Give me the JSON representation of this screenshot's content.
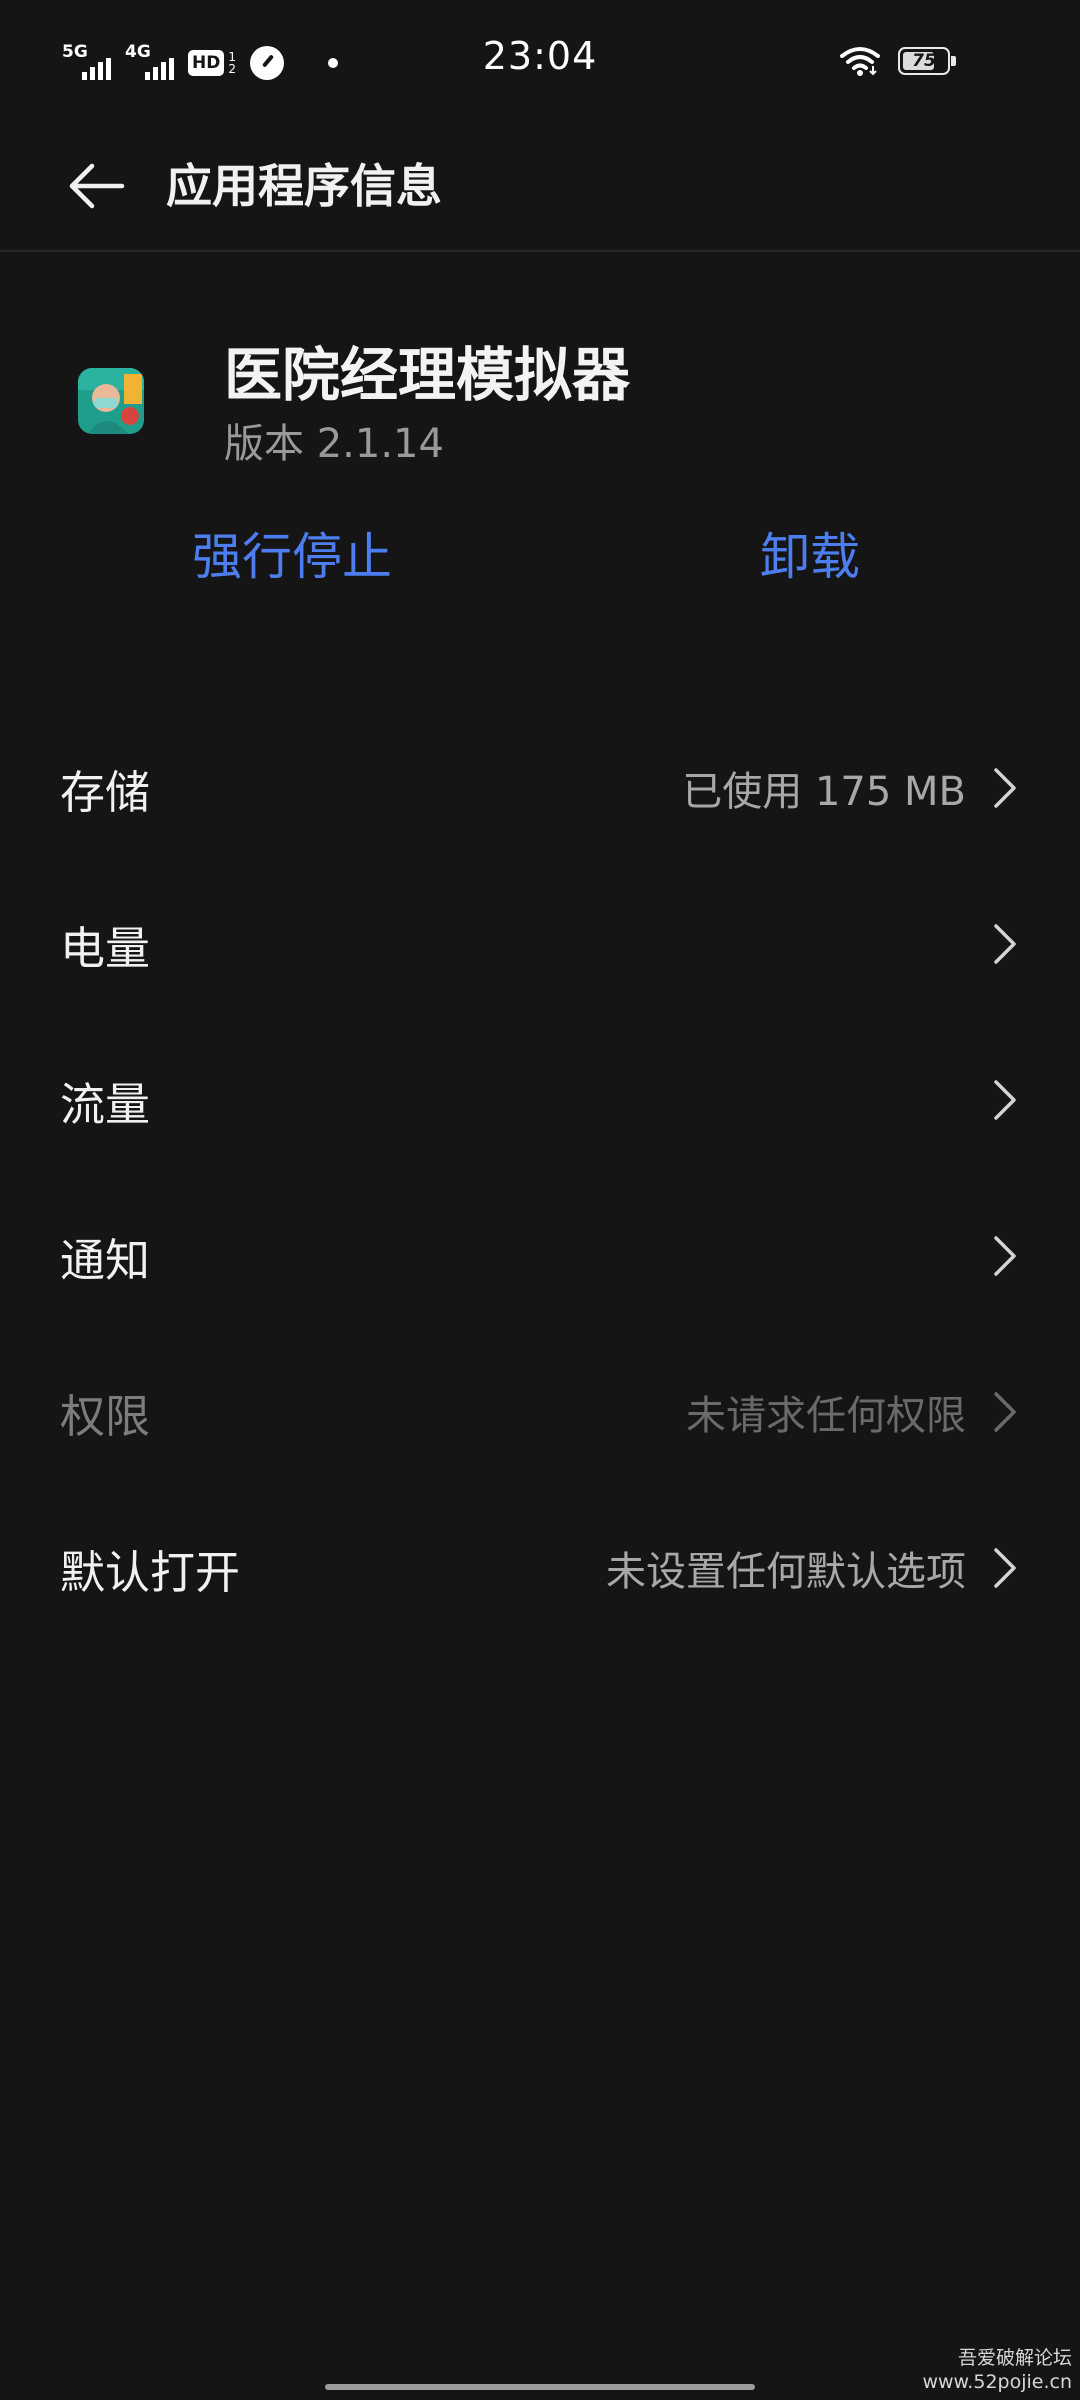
{
  "status_bar": {
    "sim1_label": "5G",
    "sim2_label": "4G",
    "hd_label": "HD",
    "hd_sub_top": "1",
    "hd_sub_bottom": "2",
    "time": "23:04",
    "battery_level": "75",
    "battery_fraction": 0.75,
    "icons": [
      "signal-icon",
      "hd-icon",
      "speedometer-icon",
      "notification-dot",
      "wifi-icon",
      "battery-icon"
    ]
  },
  "header": {
    "back_icon": "arrow-left-icon",
    "title": "应用程序信息"
  },
  "app": {
    "name": "医院经理模拟器",
    "version": "版本 2.1.14"
  },
  "actions": {
    "force_stop": "强行停止",
    "uninstall": "卸载"
  },
  "settings": [
    {
      "label": "存储",
      "value": "已使用 175 MB",
      "enabled": true
    },
    {
      "label": "电量",
      "value": "",
      "enabled": true
    },
    {
      "label": "流量",
      "value": "",
      "enabled": true
    },
    {
      "label": "通知",
      "value": "",
      "enabled": true
    },
    {
      "label": "权限",
      "value": "未请求任何权限",
      "enabled": false
    },
    {
      "label": "默认打开",
      "value": "未设置任何默认选项",
      "enabled": true
    }
  ],
  "watermark": {
    "line1": "吾爱破解论坛",
    "line2": "www.52pojie.cn"
  },
  "colors": {
    "background": "#151515",
    "accent": "#4d7ef0",
    "text_primary": "#f1f1f1",
    "text_secondary": "#a8a8a8"
  }
}
